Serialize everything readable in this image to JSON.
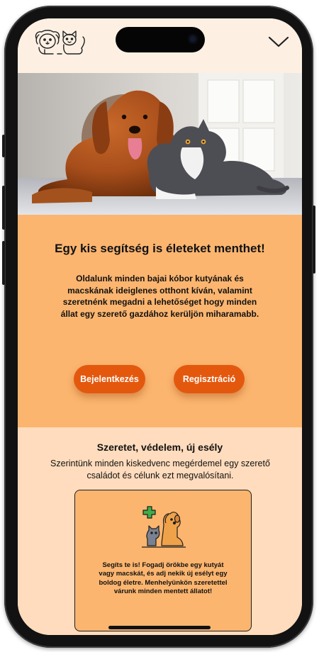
{
  "header": {
    "logo_icon": "dog-and-cat-logo-icon",
    "menu_icon": "chevron-down-icon"
  },
  "hero": {
    "image": "dog-and-cat-photo"
  },
  "intro": {
    "headline": "Egy kis segítség is életeket menthet!",
    "text": "Oldalunk minden bajai kóbor kutyának és macskának ideiglenes otthont kíván, valamint szeretnénk megadni a lehetőséget hogy minden állat egy szerető gazdához kerüljön miharamabb.",
    "login_label": "Bejelentkezés",
    "register_label": "Regisztráció"
  },
  "about": {
    "title": "Szeretet, védelem, új esély",
    "text": "Szerintünk minden kiskedvenc megérdemel egy szerető családot és célunk ezt megvalósítani."
  },
  "card": {
    "icon": "pets-with-plus-icon",
    "text": "Segíts te is! Fogadj örökbe egy kutyát vagy macskát, és adj nekik új  esélyt egy boldog életre. Menhelyünkön szeretettel várunk minden mentett állatot!"
  },
  "colors": {
    "header_bg": "#fdf0e3",
    "orange_section": "#fbb56f",
    "light_section": "#ffdcbd",
    "button": "#e4580e"
  }
}
